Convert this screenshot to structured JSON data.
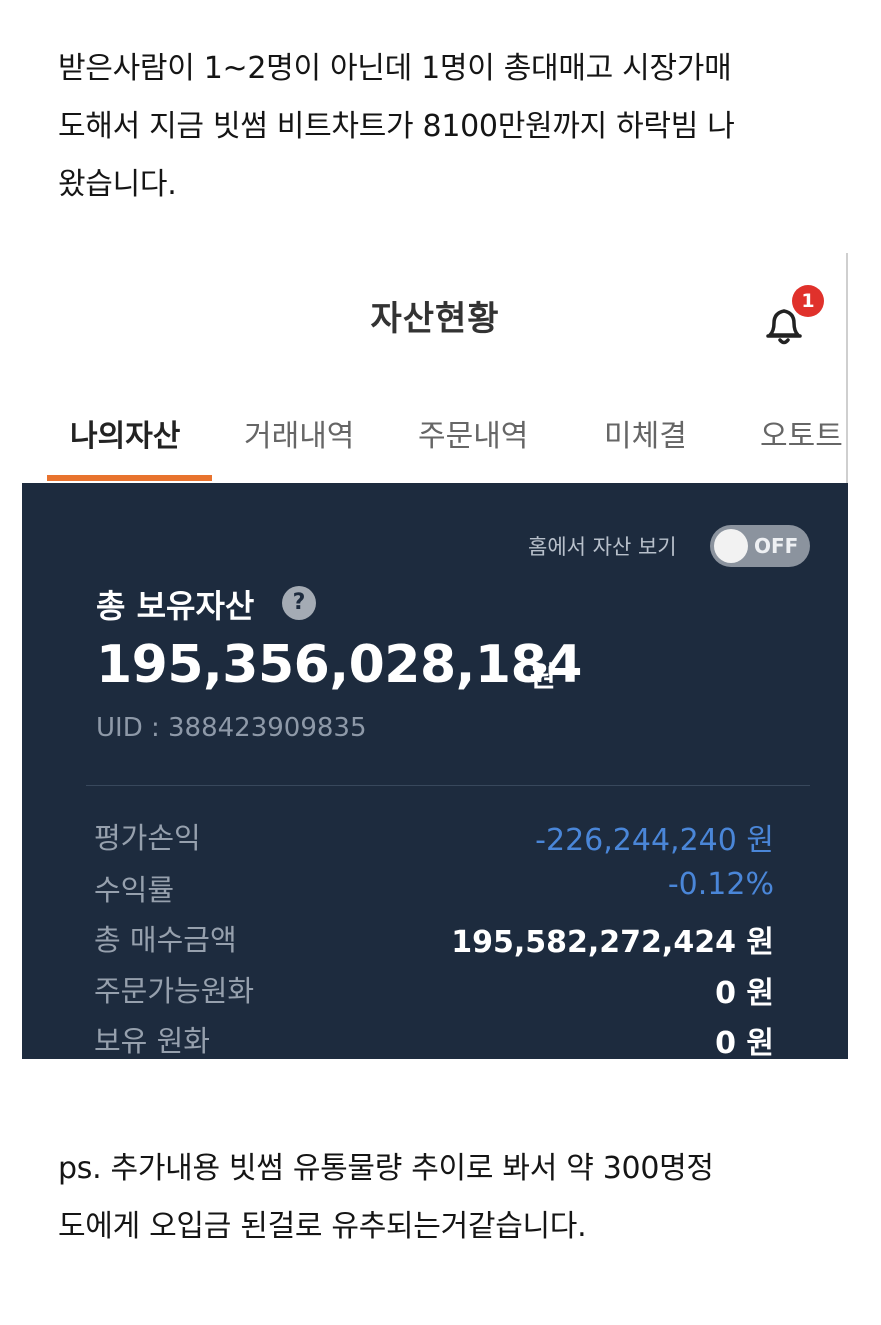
{
  "post": {
    "intro": "받은사람이 1~2명이 아닌데 1명이 총대매고 시장가매\n도해서 지금 빗썸 비트차트가 8100만원까지 하락빔 나\n왔습니다.",
    "ps": "ps. 추가내용 빗썸 유통물량 추이로 봐서 약 300명정\n도에게 오입금 된걸로 유추되는거같습니다."
  },
  "app": {
    "title": "자산현황",
    "notification_badge": "1",
    "tabs": [
      "나의자산",
      "거래내역",
      "주문내역",
      "미체결",
      "오토트"
    ],
    "active_tab": 0,
    "home_toggle_label": "홈에서 자산 보기",
    "home_toggle_state": "OFF",
    "total_label": "총 보유자산",
    "help_icon": "question-circle-icon",
    "help_glyph": "?",
    "total_value": "195,356,028,184",
    "total_unit": "원",
    "uid": "UID : 388423909835",
    "rows": [
      {
        "label": "평가손익",
        "value": "-226,244,240 원"
      },
      {
        "label": "수익률",
        "value": "-0.12%"
      },
      {
        "label": "총 매수금액",
        "value": "195,582,272,424 원"
      },
      {
        "label": "주문가능원화",
        "value": "0 원"
      },
      {
        "label": "보유 원화",
        "value": "0 원"
      }
    ]
  },
  "colors": {
    "panel_bg": "#1d2b3e",
    "accent_orange": "#e8732e",
    "negative_blue": "#4a86d8",
    "badge_red": "#e0312b"
  }
}
